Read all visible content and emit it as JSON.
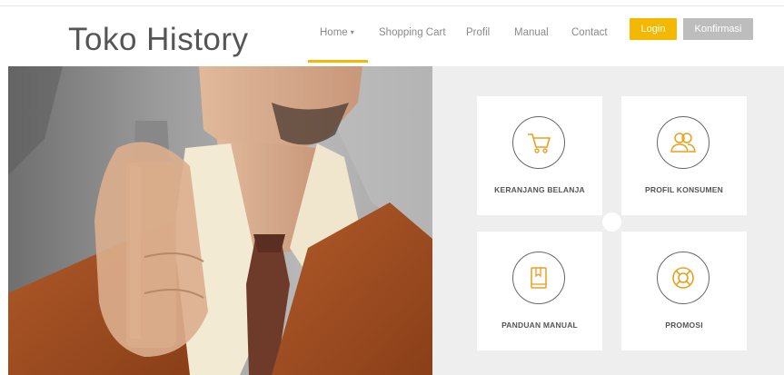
{
  "brand": {
    "title": "Toko History"
  },
  "nav": {
    "home": "Home",
    "home_caret": "▾",
    "shopping_cart": "Shopping Cart",
    "profil": "Profil",
    "manual": "Manual",
    "contact": "Contact",
    "active": "Home"
  },
  "auth": {
    "login": "Login",
    "konfirmasi": "Konfirmasi"
  },
  "tiles": [
    {
      "label": "KERANJANG BELANJA",
      "icon": "shopping-cart-icon"
    },
    {
      "label": "PROFIL KONSUMEN",
      "icon": "users-icon"
    },
    {
      "label": "PANDUAN MANUAL",
      "icon": "book-icon"
    },
    {
      "label": "PROMOSI",
      "icon": "lifebuoy-icon"
    }
  ],
  "colors": {
    "accent": "#f5b800",
    "button_gray": "#bdbdbd",
    "panel_bg": "#eeeeee",
    "icon_orange": "#e8a020",
    "text_gray": "#555555"
  }
}
